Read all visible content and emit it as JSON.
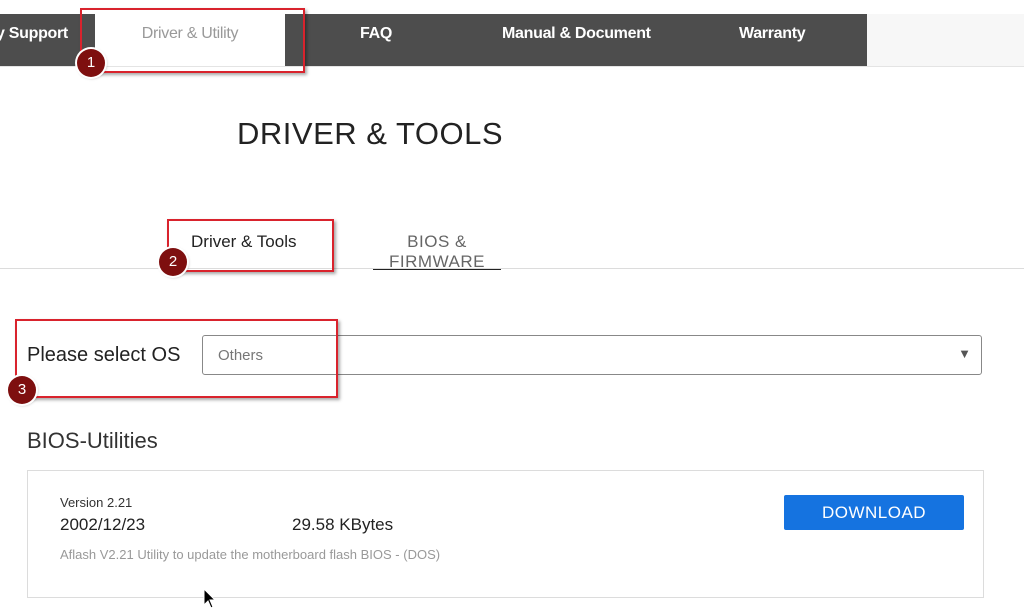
{
  "nav": {
    "items": [
      {
        "label": "y Support"
      },
      {
        "label": "Driver & Utility"
      },
      {
        "label": "FAQ"
      },
      {
        "label": "Manual & Document"
      },
      {
        "label": "Warranty"
      }
    ]
  },
  "page": {
    "title": "DRIVER & TOOLS"
  },
  "tabs": [
    {
      "label": "Driver & Tools"
    },
    {
      "label": "BIOS & FIRMWARE"
    }
  ],
  "os": {
    "label": "Please select OS",
    "value": "Others"
  },
  "section": {
    "title": "BIOS-Utilities"
  },
  "item": {
    "version": "Version 2.21",
    "date": "2002/12/23",
    "size": "29.58 KBytes",
    "description": "Aflash V2.21 Utility to update the motherboard flash BIOS - (DOS)",
    "download_label": "DOWNLOAD"
  },
  "annotations": [
    "1",
    "2",
    "3"
  ],
  "colors": {
    "accent": "#1573e0",
    "nav_bg": "#4d4d4d",
    "annotation": "#d9232d"
  }
}
